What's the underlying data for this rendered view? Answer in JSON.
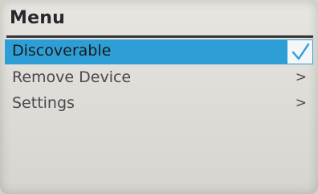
{
  "menu": {
    "title": "Menu",
    "items": [
      {
        "label": "Discoverable",
        "indicator": "check-icon",
        "selected": true
      },
      {
        "label": "Remove Device",
        "indicator": ">",
        "selected": false
      },
      {
        "label": "Settings",
        "indicator": ">",
        "selected": false
      }
    ]
  },
  "colors": {
    "highlight": "#2e9fd6",
    "check": "#2e9fd6",
    "text": "#4c4750",
    "title": "#2b272e",
    "background": "#e2e1dc"
  }
}
